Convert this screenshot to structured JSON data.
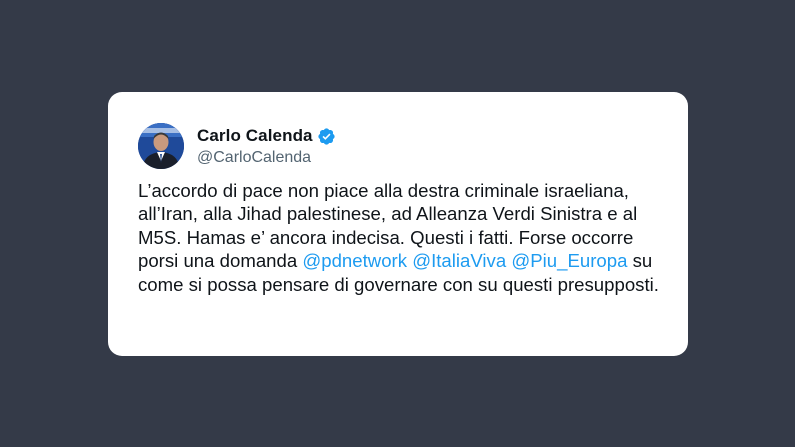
{
  "tweet": {
    "author": {
      "name": "Carlo Calenda",
      "handle": "@CarloCalenda",
      "verified": true,
      "avatar_icon": "avatar-photo",
      "verified_icon": "verified-badge-icon",
      "verified_color": "#1d9bf0"
    },
    "body": {
      "segments": [
        {
          "type": "text",
          "value": "L’accordo di pace non piace alla destra criminale israeliana, all’Iran, alla Jihad palestinese, ad Alleanza Verdi Sinistra e al M5S. Hamas e’ ancora indecisa. Questi i fatti. Forse occorre porsi una domanda "
        },
        {
          "type": "mention",
          "value": "@pdnetwork"
        },
        {
          "type": "text",
          "value": " "
        },
        {
          "type": "mention",
          "value": "@ItaliaViva"
        },
        {
          "type": "text",
          "value": " "
        },
        {
          "type": "mention",
          "value": "@Piu_Europa"
        },
        {
          "type": "text",
          "value": " su come si possa pensare di governare con su questi presupposti."
        }
      ]
    }
  },
  "colors": {
    "background": "#343a48",
    "card": "#ffffff",
    "text": "#0f1419",
    "secondary_text": "#536471",
    "mention": "#1d9bf0"
  }
}
